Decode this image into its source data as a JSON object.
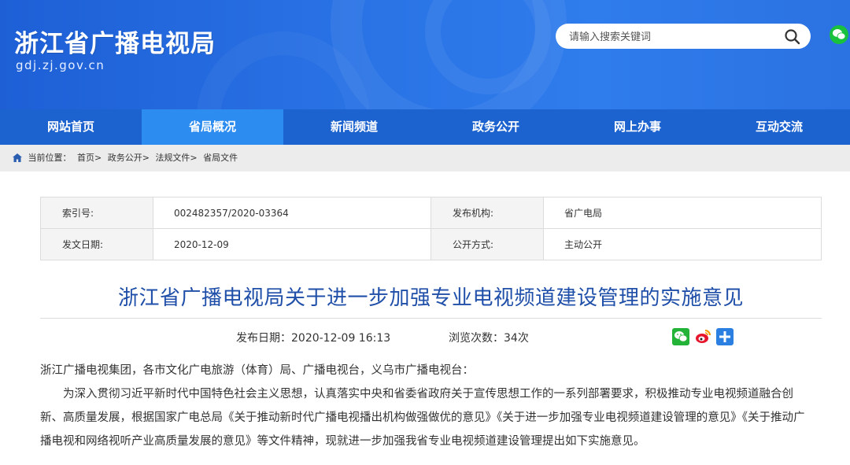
{
  "header": {
    "site_title": "浙江省广播电视局",
    "domain": "gdj.zj.gov.cn",
    "search_placeholder": "请输入搜索关键词"
  },
  "nav": {
    "items": [
      {
        "label": "网站首页"
      },
      {
        "label": "省局概况"
      },
      {
        "label": "新闻频道"
      },
      {
        "label": "政务公开"
      },
      {
        "label": "网上办事"
      },
      {
        "label": "互动交流"
      }
    ],
    "active_index": 1
  },
  "breadcrumb": {
    "prefix": "当前位置：",
    "items": [
      "首页>",
      "政务公开>",
      "法规文件>",
      "省局文件"
    ]
  },
  "info": {
    "index_label": "索引号:",
    "index_value": "002482357/2020-03364",
    "publisher_label": "发布机构:",
    "publisher_value": "省广电局",
    "date_label": "发文日期:",
    "date_value": "2020-12-09",
    "open_label": "公开方式:",
    "open_value": "主动公开"
  },
  "article": {
    "title": "浙江省广播电视局关于进一步加强专业电视频道建设管理的实施意见",
    "publish_date": "发布日期：2020-12-09 16:13",
    "views": "浏览次数：34次",
    "recipients": "浙江广播电视集团，各市文化广电旅游（体育）局、广播电视台，义乌市广播电视台：",
    "paragraph": "为深入贯彻习近平新时代中国特色社会主义思想，认真落实中央和省委省政府关于宣传思想工作的一系列部署要求，积极推动专业电视频道融合创新、高质量发展，根据国家广电总局《关于推动新时代广播电视播出机构做强做优的意见》《关于进一步加强专业电视频道建设管理的意见》《关于推动广播电视和网络视听产业高质量发展的意见》等文件精神，现就进一步加强我省专业电视频道建设管理提出如下实施意见。"
  },
  "colors": {
    "header_blue": "#2a74e6",
    "nav_blue": "#1d63cf",
    "nav_active": "#2d8cf0",
    "title_blue": "#1f4fa8",
    "wechat_green": "#24b339"
  },
  "icons": [
    "search-icon",
    "wechat-icon",
    "home-icon",
    "weibo-icon",
    "plus-icon"
  ]
}
